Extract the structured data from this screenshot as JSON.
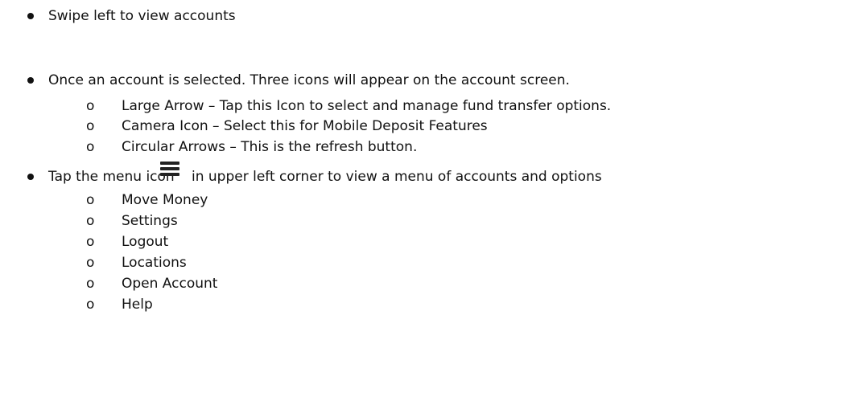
{
  "bullets": [
    {
      "text": "Swipe left to view accounts"
    },
    {
      "text": "Once an account is selected. Three icons will appear on the account screen.",
      "sub_items": [
        "Large Arrow – Tap this Icon to select and manage fund transfer options.",
        "Camera Icon – Select this for Mobile Deposit Features",
        "Circular Arrows – This is the refresh button."
      ]
    },
    {
      "text_before_icon": "Tap the menu icon",
      "icon": "menu-icon",
      "text_after_icon": "in upper left corner to view a menu of accounts and options",
      "sub_items": [
        "Move Money",
        "Settings",
        "Logout",
        "Locations",
        "Open Account",
        "Help"
      ]
    }
  ],
  "sub_marker": "o"
}
